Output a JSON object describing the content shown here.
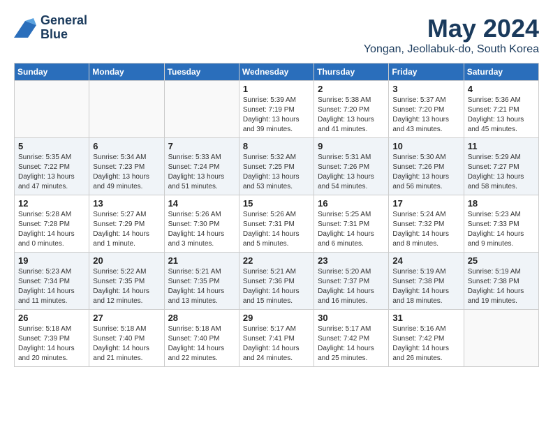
{
  "header": {
    "logo_line1": "General",
    "logo_line2": "Blue",
    "main_title": "May 2024",
    "subtitle": "Yongan, Jeollabuk-do, South Korea"
  },
  "days_of_week": [
    "Sunday",
    "Monday",
    "Tuesday",
    "Wednesday",
    "Thursday",
    "Friday",
    "Saturday"
  ],
  "weeks": [
    [
      {
        "day": "",
        "info": ""
      },
      {
        "day": "",
        "info": ""
      },
      {
        "day": "",
        "info": ""
      },
      {
        "day": "1",
        "info": "Sunrise: 5:39 AM\nSunset: 7:19 PM\nDaylight: 13 hours\nand 39 minutes."
      },
      {
        "day": "2",
        "info": "Sunrise: 5:38 AM\nSunset: 7:20 PM\nDaylight: 13 hours\nand 41 minutes."
      },
      {
        "day": "3",
        "info": "Sunrise: 5:37 AM\nSunset: 7:20 PM\nDaylight: 13 hours\nand 43 minutes."
      },
      {
        "day": "4",
        "info": "Sunrise: 5:36 AM\nSunset: 7:21 PM\nDaylight: 13 hours\nand 45 minutes."
      }
    ],
    [
      {
        "day": "5",
        "info": "Sunrise: 5:35 AM\nSunset: 7:22 PM\nDaylight: 13 hours\nand 47 minutes."
      },
      {
        "day": "6",
        "info": "Sunrise: 5:34 AM\nSunset: 7:23 PM\nDaylight: 13 hours\nand 49 minutes."
      },
      {
        "day": "7",
        "info": "Sunrise: 5:33 AM\nSunset: 7:24 PM\nDaylight: 13 hours\nand 51 minutes."
      },
      {
        "day": "8",
        "info": "Sunrise: 5:32 AM\nSunset: 7:25 PM\nDaylight: 13 hours\nand 53 minutes."
      },
      {
        "day": "9",
        "info": "Sunrise: 5:31 AM\nSunset: 7:26 PM\nDaylight: 13 hours\nand 54 minutes."
      },
      {
        "day": "10",
        "info": "Sunrise: 5:30 AM\nSunset: 7:26 PM\nDaylight: 13 hours\nand 56 minutes."
      },
      {
        "day": "11",
        "info": "Sunrise: 5:29 AM\nSunset: 7:27 PM\nDaylight: 13 hours\nand 58 minutes."
      }
    ],
    [
      {
        "day": "12",
        "info": "Sunrise: 5:28 AM\nSunset: 7:28 PM\nDaylight: 14 hours\nand 0 minutes."
      },
      {
        "day": "13",
        "info": "Sunrise: 5:27 AM\nSunset: 7:29 PM\nDaylight: 14 hours\nand 1 minute."
      },
      {
        "day": "14",
        "info": "Sunrise: 5:26 AM\nSunset: 7:30 PM\nDaylight: 14 hours\nand 3 minutes."
      },
      {
        "day": "15",
        "info": "Sunrise: 5:26 AM\nSunset: 7:31 PM\nDaylight: 14 hours\nand 5 minutes."
      },
      {
        "day": "16",
        "info": "Sunrise: 5:25 AM\nSunset: 7:31 PM\nDaylight: 14 hours\nand 6 minutes."
      },
      {
        "day": "17",
        "info": "Sunrise: 5:24 AM\nSunset: 7:32 PM\nDaylight: 14 hours\nand 8 minutes."
      },
      {
        "day": "18",
        "info": "Sunrise: 5:23 AM\nSunset: 7:33 PM\nDaylight: 14 hours\nand 9 minutes."
      }
    ],
    [
      {
        "day": "19",
        "info": "Sunrise: 5:23 AM\nSunset: 7:34 PM\nDaylight: 14 hours\nand 11 minutes."
      },
      {
        "day": "20",
        "info": "Sunrise: 5:22 AM\nSunset: 7:35 PM\nDaylight: 14 hours\nand 12 minutes."
      },
      {
        "day": "21",
        "info": "Sunrise: 5:21 AM\nSunset: 7:35 PM\nDaylight: 14 hours\nand 13 minutes."
      },
      {
        "day": "22",
        "info": "Sunrise: 5:21 AM\nSunset: 7:36 PM\nDaylight: 14 hours\nand 15 minutes."
      },
      {
        "day": "23",
        "info": "Sunrise: 5:20 AM\nSunset: 7:37 PM\nDaylight: 14 hours\nand 16 minutes."
      },
      {
        "day": "24",
        "info": "Sunrise: 5:19 AM\nSunset: 7:38 PM\nDaylight: 14 hours\nand 18 minutes."
      },
      {
        "day": "25",
        "info": "Sunrise: 5:19 AM\nSunset: 7:38 PM\nDaylight: 14 hours\nand 19 minutes."
      }
    ],
    [
      {
        "day": "26",
        "info": "Sunrise: 5:18 AM\nSunset: 7:39 PM\nDaylight: 14 hours\nand 20 minutes."
      },
      {
        "day": "27",
        "info": "Sunrise: 5:18 AM\nSunset: 7:40 PM\nDaylight: 14 hours\nand 21 minutes."
      },
      {
        "day": "28",
        "info": "Sunrise: 5:18 AM\nSunset: 7:40 PM\nDaylight: 14 hours\nand 22 minutes."
      },
      {
        "day": "29",
        "info": "Sunrise: 5:17 AM\nSunset: 7:41 PM\nDaylight: 14 hours\nand 24 minutes."
      },
      {
        "day": "30",
        "info": "Sunrise: 5:17 AM\nSunset: 7:42 PM\nDaylight: 14 hours\nand 25 minutes."
      },
      {
        "day": "31",
        "info": "Sunrise: 5:16 AM\nSunset: 7:42 PM\nDaylight: 14 hours\nand 26 minutes."
      },
      {
        "day": "",
        "info": ""
      }
    ]
  ]
}
